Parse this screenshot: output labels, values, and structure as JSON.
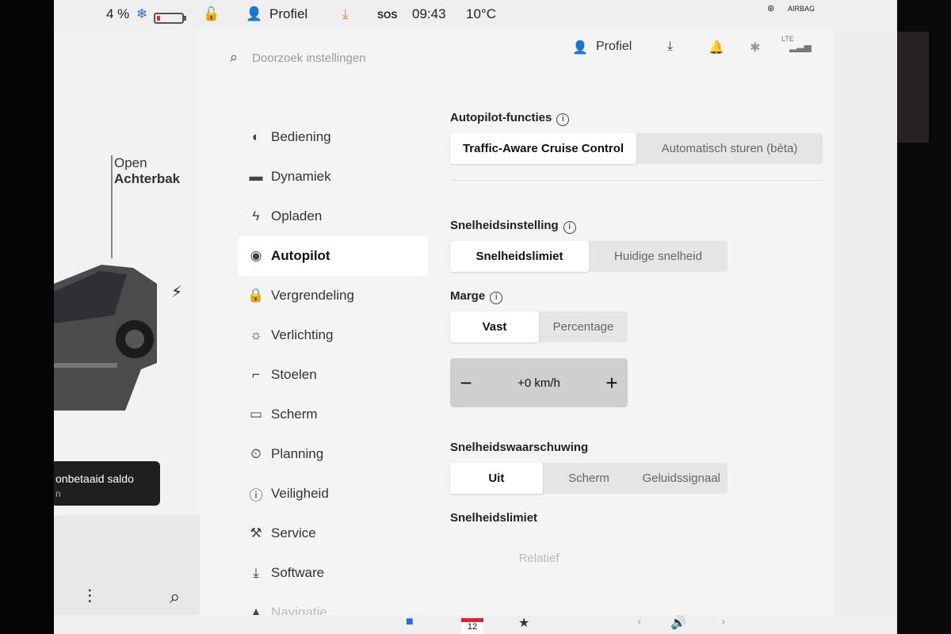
{
  "status": {
    "battery_percent": "4 %",
    "profile_label": "Profiel",
    "sos": "SOS",
    "time": "09:43",
    "temperature": "10°C",
    "airbag": "AIRBAG",
    "snow_icon": "snowflake-icon",
    "lock_icon": "unlock-icon"
  },
  "car": {
    "trunk_line1": "Open",
    "trunk_line2": "Achterbak",
    "alert_text": "onbetaaid saldo",
    "alert_sub": "n"
  },
  "header": {
    "search_placeholder": "Doorzoek instellingen",
    "profile_label": "Profiel",
    "lte": "LTE"
  },
  "menu": [
    {
      "label": "Bediening",
      "icon": "toggle-icon",
      "glyph": "◐"
    },
    {
      "label": "Dynamiek",
      "icon": "car-icon",
      "glyph": "🚘"
    },
    {
      "label": "Opladen",
      "icon": "bolt-icon",
      "glyph": "⚡"
    },
    {
      "label": "Autopilot",
      "icon": "steering-wheel-icon",
      "glyph": "◉"
    },
    {
      "label": "Vergrendeling",
      "icon": "lock-icon",
      "glyph": "🔒"
    },
    {
      "label": "Verlichting",
      "icon": "sun-icon",
      "glyph": "☼"
    },
    {
      "label": "Stoelen",
      "icon": "seat-icon",
      "glyph": "⌐"
    },
    {
      "label": "Scherm",
      "icon": "screen-icon",
      "glyph": "▭"
    },
    {
      "label": "Planning",
      "icon": "clock-icon",
      "glyph": "⏰"
    },
    {
      "label": "Veiligheid",
      "icon": "alert-icon",
      "glyph": "ⓘ"
    },
    {
      "label": "Service",
      "icon": "wrench-icon",
      "glyph": "🔧"
    },
    {
      "label": "Software",
      "icon": "download-icon",
      "glyph": "⤓"
    },
    {
      "label": "Navigatie",
      "icon": "navigation-icon",
      "glyph": "▲"
    }
  ],
  "autopilot": {
    "features_title": "Autopilot-functies",
    "features_options": [
      "Traffic-Aware Cruise Control",
      "Automatisch sturen (bèta)"
    ],
    "speed_setting_title": "Snelheidsinstelling",
    "speed_setting_options": [
      "Snelheidslimiet",
      "Huidige snelheid"
    ],
    "margin_title": "Marge",
    "margin_options": [
      "Vast",
      "Percentage"
    ],
    "offset_value": "+0 km/h",
    "warning_title": "Snelheidswaarschuwing",
    "warning_options": [
      "Uit",
      "Scherm",
      "Geluidssignaal"
    ],
    "limit_title": "Snelheidslimiet",
    "limit_options": [
      "Relatief"
    ]
  },
  "dock": {
    "calendar_day": "12"
  }
}
